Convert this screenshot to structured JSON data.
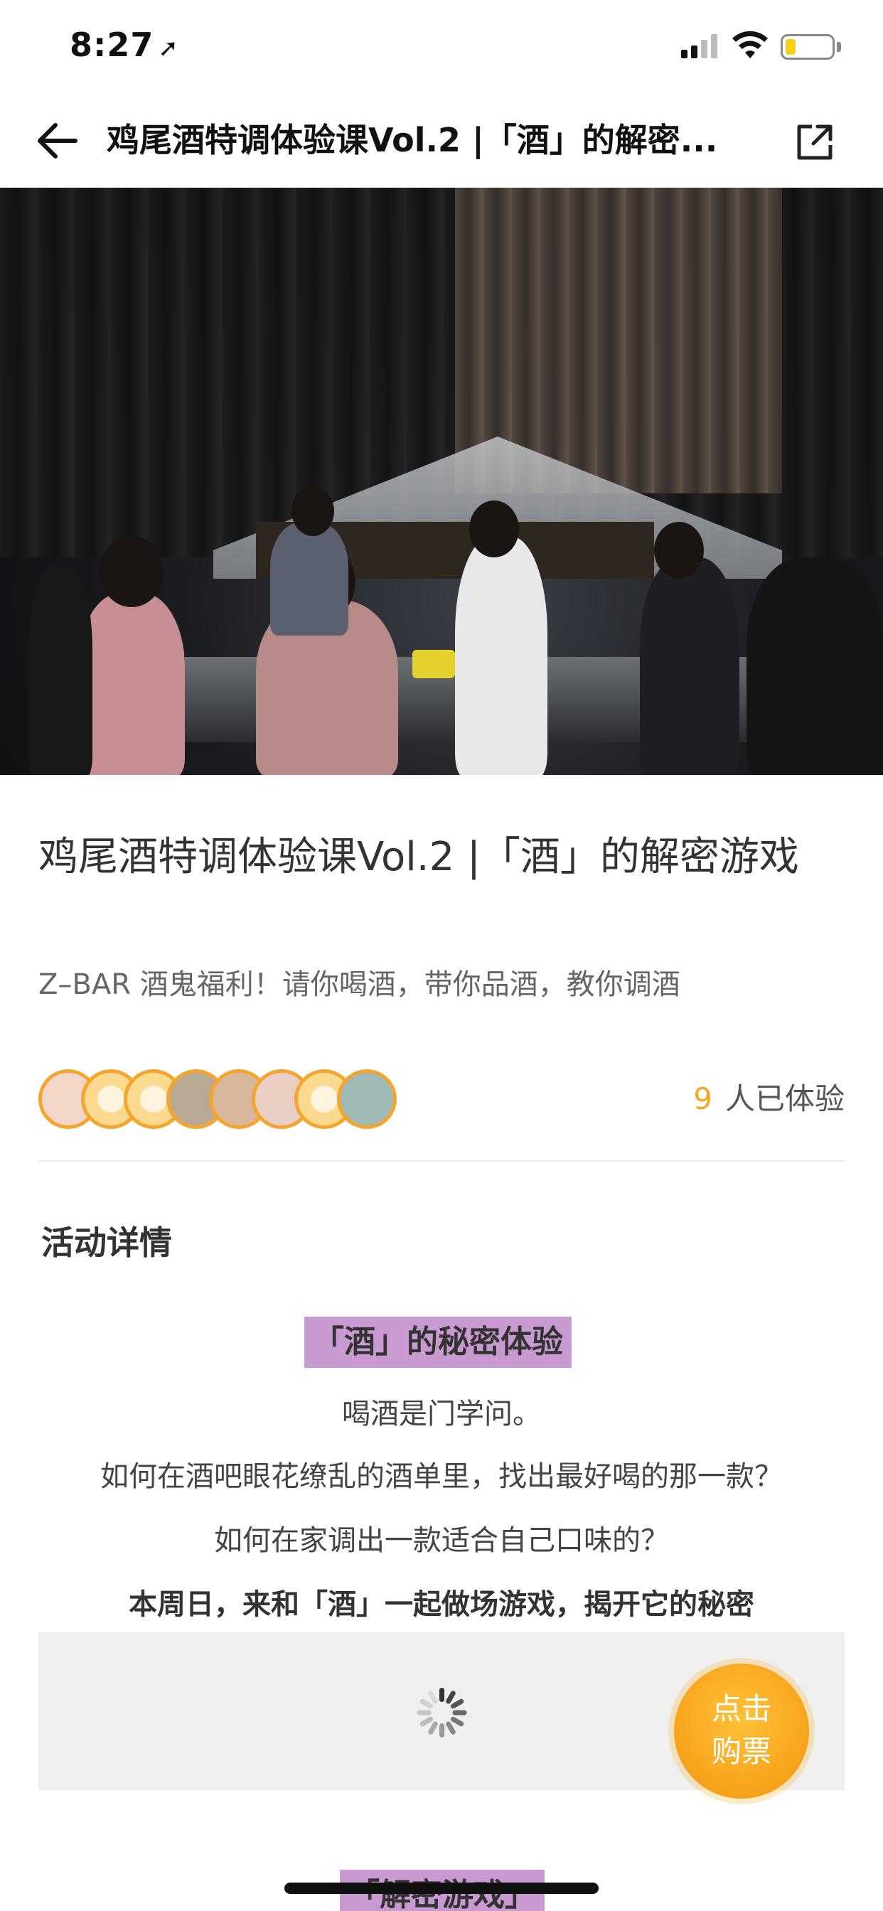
{
  "status_bar": {
    "time": "8:27",
    "location_icon": "location-arrow-icon",
    "battery_color": "#f7d117"
  },
  "nav": {
    "title": "鸡尾酒特调体验课Vol.2 |「酒」的解密...",
    "back_icon": "arrow-left-icon",
    "share_icon": "external-share-icon"
  },
  "event": {
    "title": "鸡尾酒特调体验课Vol.2 |「酒」的解密游戏",
    "subtitle": "Z–BAR 酒鬼福利！请你喝酒，带你品酒，教你调酒",
    "participant_count": "9",
    "participant_suffix": "人已体验"
  },
  "details": {
    "section_title": "活动详情",
    "tag": "「酒」的秘密体验",
    "lines": [
      "喝酒是门学问。",
      "如何在酒吧眼花缭乱的酒单里，找出最好喝的那一款？",
      "如何在家调出一款适合自己口味的？"
    ],
    "bold_line": "本周日，来和「酒」一起做场游戏，揭开它的秘密",
    "next_tag": "「解密游戏」"
  },
  "buy_button": {
    "line1": "点击",
    "line2": "购票"
  },
  "colors": {
    "accent_orange": "#f5a623",
    "tag_purple": "#c99ad2",
    "section_highlight": "#fde3a2"
  }
}
